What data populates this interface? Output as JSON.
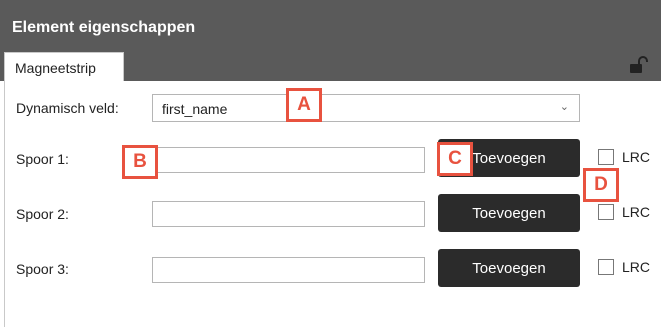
{
  "window": {
    "title": "Element eigenschappen"
  },
  "tabs": [
    {
      "label": "Magneetstrip"
    }
  ],
  "dynamic_field": {
    "label": "Dynamisch veld:",
    "value": "first_name"
  },
  "tracks": [
    {
      "label": "Spoor 1:",
      "value": "",
      "button": "Toevoegen",
      "checkbox_label": "LRC",
      "checked": false
    },
    {
      "label": "Spoor 2:",
      "value": "",
      "button": "Toevoegen",
      "checkbox_label": "LRC",
      "checked": false
    },
    {
      "label": "Spoor 3:",
      "value": "",
      "button": "Toevoegen",
      "checkbox_label": "LRC",
      "checked": false
    }
  ],
  "markers": [
    "A",
    "B",
    "C",
    "D"
  ],
  "colors": {
    "header": "#5a5a5a",
    "button": "#2b2b2b",
    "marker": "#e8523f"
  },
  "icons": {
    "lock": "unlocked-padlock-icon",
    "dropdown": "chevron-down-icon"
  }
}
